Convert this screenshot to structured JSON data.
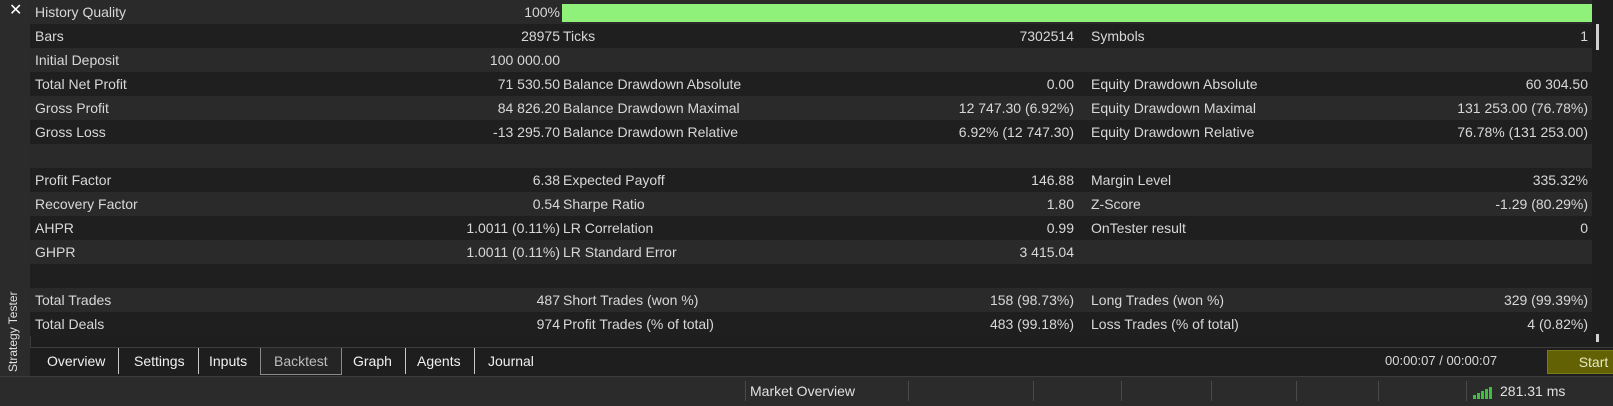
{
  "window": {
    "close_glyph": "✕",
    "side_label": "Strategy Tester"
  },
  "colors": {
    "quality_bar": "#8ff07a",
    "start_button": "#626205",
    "signal": "#3fbf3f"
  },
  "report": {
    "history_quality": {
      "label": "History Quality",
      "value": "100%",
      "fill_percent": 100
    },
    "rows": [
      {
        "c1": {
          "label": "Bars",
          "value": "28975"
        },
        "c2": {
          "label": "Ticks",
          "value": "7302514"
        },
        "c3": {
          "label": "Symbols",
          "value": "1"
        }
      },
      {
        "c1": {
          "label": "Initial Deposit",
          "value": "100 000.00"
        },
        "c2": {
          "label": "",
          "value": ""
        },
        "c3": {
          "label": "",
          "value": ""
        }
      },
      {
        "c1": {
          "label": "Total Net Profit",
          "value": "71 530.50"
        },
        "c2": {
          "label": "Balance Drawdown Absolute",
          "value": "0.00"
        },
        "c3": {
          "label": "Equity Drawdown Absolute",
          "value": "60 304.50"
        }
      },
      {
        "c1": {
          "label": "Gross Profit",
          "value": "84 826.20"
        },
        "c2": {
          "label": "Balance Drawdown Maximal",
          "value": "12 747.30 (6.92%)"
        },
        "c3": {
          "label": "Equity Drawdown Maximal",
          "value": "131 253.00 (76.78%)"
        }
      },
      {
        "c1": {
          "label": "Gross Loss",
          "value": "-13 295.70"
        },
        "c2": {
          "label": "Balance Drawdown Relative",
          "value": "6.92% (12 747.30)"
        },
        "c3": {
          "label": "Equity Drawdown Relative",
          "value": "76.78% (131 253.00)"
        }
      },
      {
        "c1": {
          "label": "",
          "value": ""
        },
        "c2": {
          "label": "",
          "value": ""
        },
        "c3": {
          "label": "",
          "value": ""
        }
      },
      {
        "c1": {
          "label": "Profit Factor",
          "value": "6.38"
        },
        "c2": {
          "label": "Expected Payoff",
          "value": "146.88"
        },
        "c3": {
          "label": "Margin Level",
          "value": "335.32%"
        }
      },
      {
        "c1": {
          "label": "Recovery Factor",
          "value": "0.54"
        },
        "c2": {
          "label": "Sharpe Ratio",
          "value": "1.80"
        },
        "c3": {
          "label": "Z-Score",
          "value": "-1.29 (80.29%)"
        }
      },
      {
        "c1": {
          "label": "AHPR",
          "value": "1.0011 (0.11%)"
        },
        "c2": {
          "label": "LR Correlation",
          "value": "0.99"
        },
        "c3": {
          "label": "OnTester result",
          "value": "0"
        }
      },
      {
        "c1": {
          "label": "GHPR",
          "value": "1.0011 (0.11%)"
        },
        "c2": {
          "label": "LR Standard Error",
          "value": "3 415.04"
        },
        "c3": {
          "label": "",
          "value": ""
        }
      },
      {
        "c1": {
          "label": "",
          "value": ""
        },
        "c2": {
          "label": "",
          "value": ""
        },
        "c3": {
          "label": "",
          "value": ""
        }
      },
      {
        "c1": {
          "label": "Total Trades",
          "value": "487"
        },
        "c2": {
          "label": "Short Trades (won %)",
          "value": "158 (98.73%)"
        },
        "c3": {
          "label": "Long Trades (won %)",
          "value": "329 (99.39%)"
        }
      },
      {
        "c1": {
          "label": "Total Deals",
          "value": "974"
        },
        "c2": {
          "label": "Profit Trades (% of total)",
          "value": "483 (99.18%)"
        },
        "c3": {
          "label": "Loss Trades (% of total)",
          "value": "4 (0.82%)"
        }
      }
    ]
  },
  "tabs": [
    {
      "label": "Overview"
    },
    {
      "label": "Settings"
    },
    {
      "label": "Inputs"
    },
    {
      "label": "Backtest"
    },
    {
      "label": "Graph"
    },
    {
      "label": "Agents"
    },
    {
      "label": "Journal"
    }
  ],
  "active_tab": "Backtest",
  "timer": "00:00:07 / 00:00:07",
  "start_label": "Start",
  "statusbar": {
    "market_overview": "Market Overview",
    "ping": "281.31 ms",
    "icon": "signal-bars-icon"
  }
}
